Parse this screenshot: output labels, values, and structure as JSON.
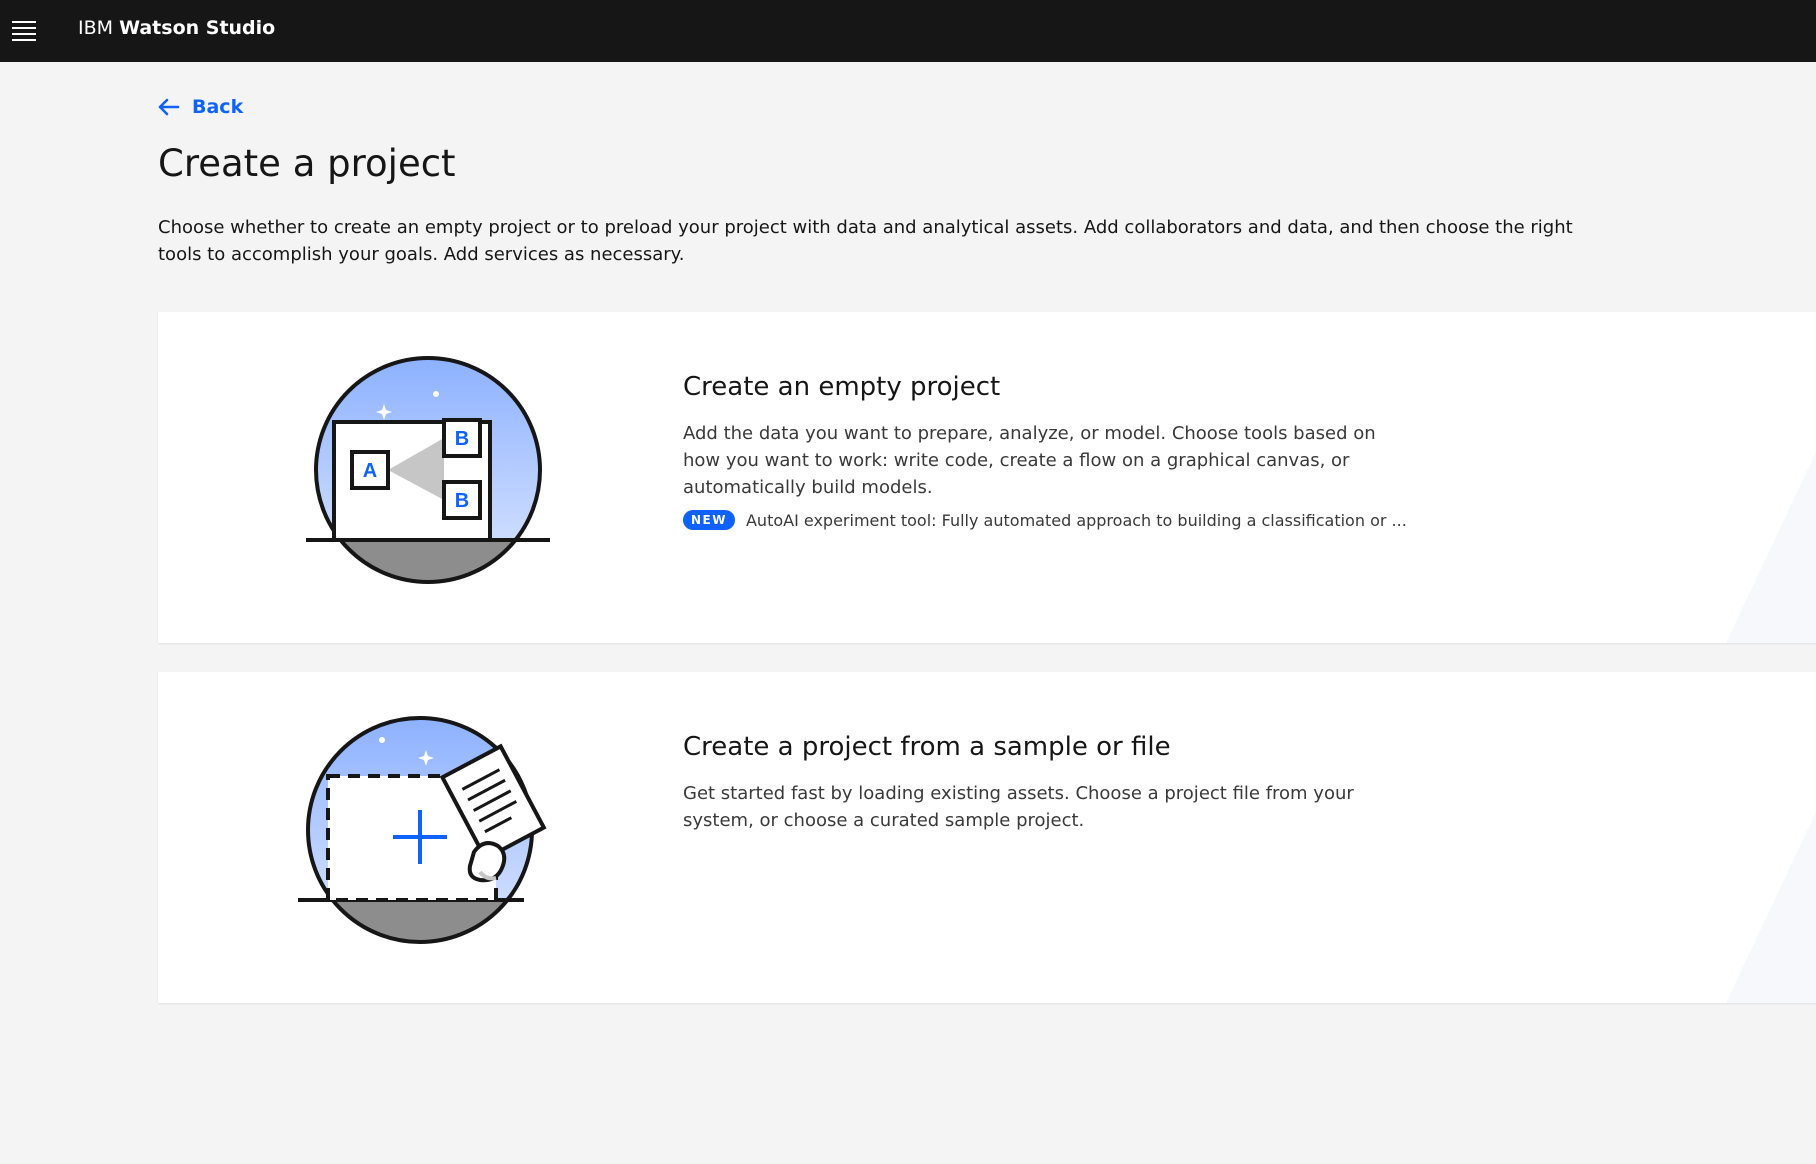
{
  "header": {
    "brand_prefix": "IBM",
    "brand_name": "Watson Studio"
  },
  "back": {
    "label": "Back"
  },
  "page": {
    "title": "Create a project",
    "description": "Choose whether to create an empty project or to preload your project with data and analytical assets. Add collaborators and data, and then choose the right tools to accomplish your goals. Add services as necessary."
  },
  "cards": [
    {
      "title": "Create an empty project",
      "description": "Add the data you want to prepare, analyze, or model. Choose tools based on how you want to work: write code, create a flow on a graphical canvas, or automatically build models.",
      "badge": "NEW",
      "new_text": "AutoAI experiment tool: Fully automated approach to building a classification or ..."
    },
    {
      "title": "Create a project from a sample or file",
      "description": "Get started fast by loading existing assets. Choose a project file from your system, or choose a curated sample project."
    }
  ],
  "illustration_letters": {
    "a": "A",
    "b": "B"
  },
  "colors": {
    "header_bg": "#161616",
    "page_bg": "#f4f4f4",
    "accent": "#0f62fe",
    "card_bg": "#ffffff"
  }
}
